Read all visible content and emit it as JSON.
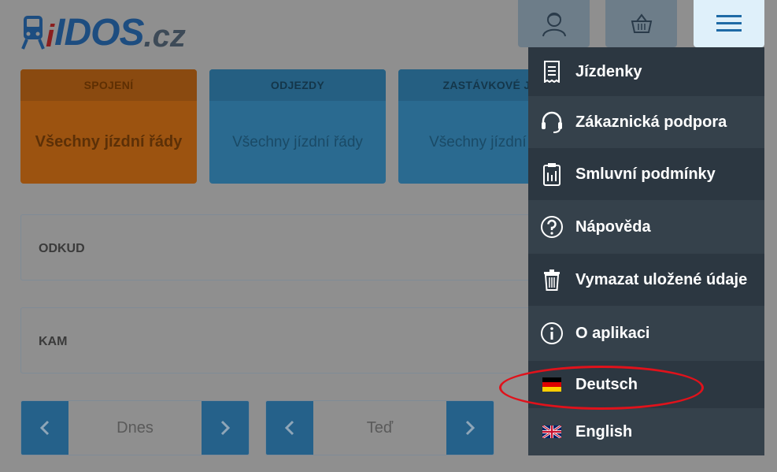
{
  "logo": {
    "brand_i": "i",
    "brand_name": "IDOS",
    "brand_tld": ".cz"
  },
  "header": {
    "user_icon": "user-icon",
    "cart_icon": "basket-icon",
    "menu_icon": "hamburger-icon"
  },
  "tabs": [
    {
      "title": "SPOJENÍ",
      "subtitle": "Všechny jízdní řády"
    },
    {
      "title": "ODJEZDY",
      "subtitle": "Všechny jízdní řády"
    },
    {
      "title": "ZASTÁVKOVÉ J",
      "subtitle": "Všechny jízdní řá"
    }
  ],
  "form": {
    "from_label": "ODKUD",
    "to_label": "KAM",
    "day_value": "Dnes",
    "time_value": "Teď"
  },
  "menu": {
    "items": [
      {
        "label": "Jízdenky",
        "icon": "ticket-icon"
      },
      {
        "label": "Zákaznická podpora",
        "icon": "headset-icon"
      },
      {
        "label": "Smluvní podmínky",
        "icon": "clipboard-icon"
      },
      {
        "label": "Nápověda",
        "icon": "question-icon"
      },
      {
        "label": "Vymazat uložené údaje",
        "icon": "trash-icon"
      },
      {
        "label": "O aplikaci",
        "icon": "info-icon"
      },
      {
        "label": "Deutsch",
        "icon": "german-flag-icon"
      },
      {
        "label": "English",
        "icon": "uk-flag-icon"
      }
    ]
  },
  "colors": {
    "overlay": "#8f8f8f",
    "menu_bg": "#2c3741",
    "accent_orange": "#9c5310",
    "accent_blue": "#2a6a90",
    "highlight": "#e0121b"
  }
}
